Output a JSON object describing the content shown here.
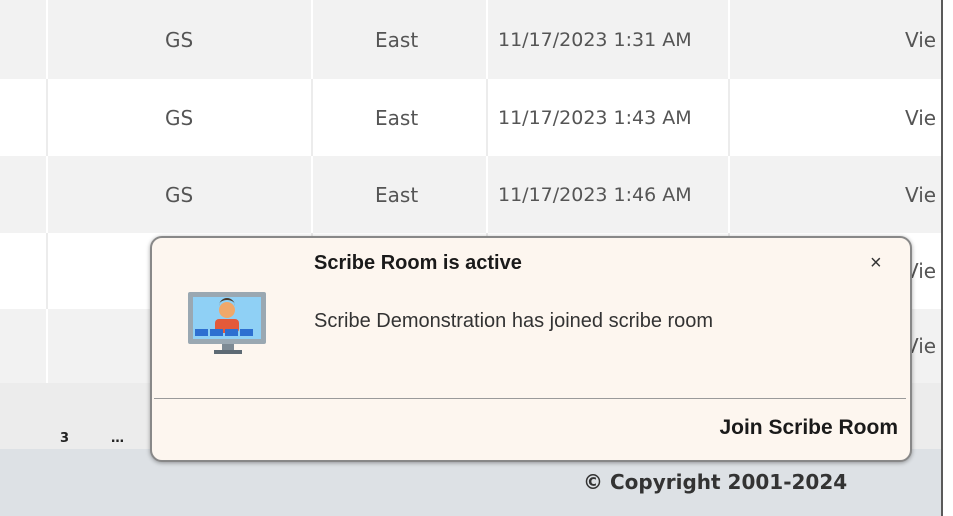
{
  "rows": [
    {
      "code": "GS",
      "region": "East",
      "time": "11/17/2023 1:31 AM",
      "action": "Vie"
    },
    {
      "code": "GS",
      "region": "East",
      "time": "11/17/2023 1:43 AM",
      "action": "Vie"
    },
    {
      "code": "GS",
      "region": "East",
      "time": "11/17/2023 1:46 AM",
      "action": "Vie"
    },
    {
      "code": "",
      "region": "",
      "time": "",
      "action": "Vie"
    },
    {
      "code": "",
      "region": "",
      "time": "",
      "action": "Vie"
    }
  ],
  "pager": {
    "page": "3",
    "ellipsis": "…"
  },
  "footer": {
    "copyright": "© Copyright 2001-2024"
  },
  "toast": {
    "title": "Scribe Room is active",
    "close": "×",
    "message": "Scribe Demonstration has joined scribe room",
    "action": "Join Scribe Room",
    "icon": "monitor-user-icon"
  }
}
